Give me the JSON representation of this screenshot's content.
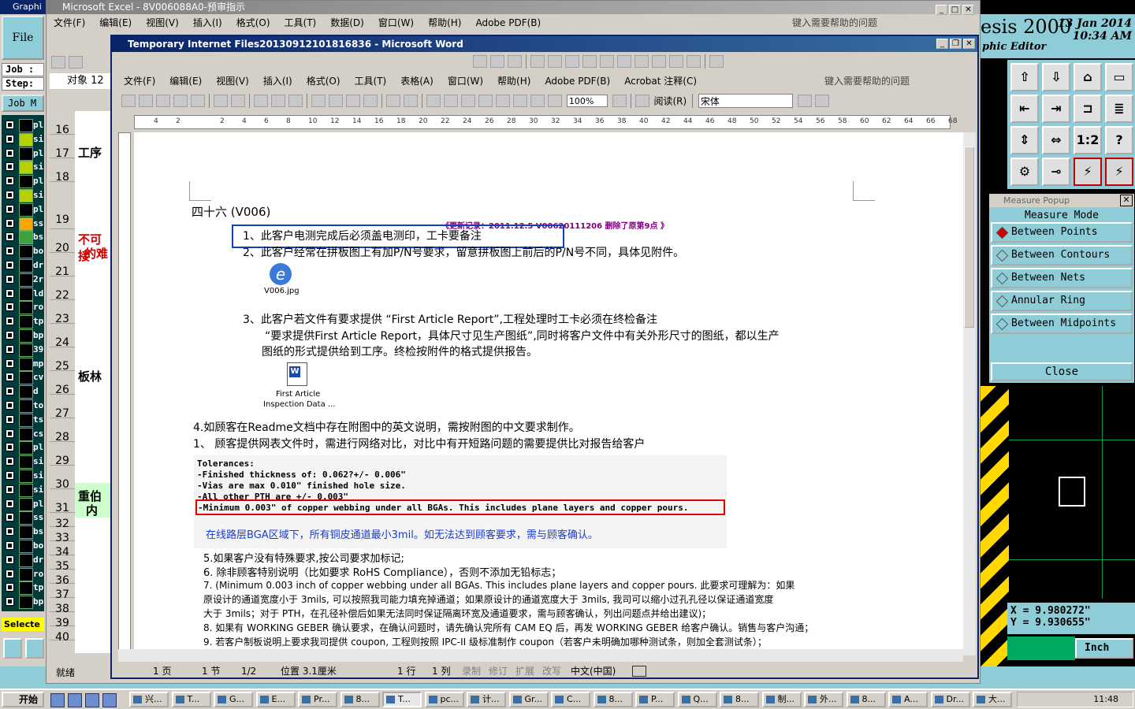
{
  "genesis": {
    "left_title": "Graphi",
    "file_button": "File",
    "job_label": "Job :",
    "step_label": "Step:",
    "job_menu": "Job M",
    "layers": [
      "pl",
      "si",
      "pl",
      "si",
      "pl",
      "si",
      "pl",
      "ss",
      "bs",
      "bo",
      "dr",
      "2r",
      "ld",
      "ro",
      "tp",
      "bp",
      "39",
      "mp",
      "cv",
      "d",
      "to",
      "ts",
      "cs",
      "pl",
      "si",
      "si",
      "si",
      "pl",
      "ss",
      "bs",
      "bo",
      "dr",
      "ro",
      "tp",
      "bp"
    ],
    "selected_label": "Selecte",
    "app_title": "esis 2000",
    "app_subtitle": "phic Editor",
    "date": "13 Jan 2014",
    "time": "10:34 AM",
    "tools": [
      "⇧",
      "⇩",
      "⌂",
      "▭",
      "⇤",
      "⇥",
      "⊐",
      "≣",
      "⇕",
      "⇔",
      "1:2",
      "?",
      "⚙",
      "⊸",
      "⚡",
      "⚡"
    ],
    "x_readout": "X = 9.980272\"",
    "y_readout": "Y = 9.930655\"",
    "units": "Inch"
  },
  "measure_popup": {
    "title": "Measure Popup",
    "mode_label": "Measure Mode",
    "options": [
      {
        "label": "Between Points",
        "selected": true
      },
      {
        "label": "Between Contours",
        "selected": false
      },
      {
        "label": "Between Nets",
        "selected": false
      },
      {
        "label": "Annular Ring",
        "selected": false
      },
      {
        "label": "Between Midpoints",
        "selected": false
      }
    ],
    "close": "Close"
  },
  "excel": {
    "title": "Microsoft Excel - 8V006088A0-预审指示",
    "menu": [
      "文件(F)",
      "编辑(E)",
      "视图(V)",
      "插入(I)",
      "格式(O)",
      "工具(T)",
      "数据(D)",
      "窗口(W)",
      "帮助(H)",
      "Adobe PDF(B)"
    ],
    "help_placeholder": "键入需要帮助的问题",
    "namebox": "对象 12",
    "rows": [
      "16",
      "17",
      "18",
      "19",
      "20",
      "21",
      "22",
      "23",
      "24",
      "25",
      "26",
      "27",
      "28",
      "29",
      "30",
      "31",
      "32",
      "33",
      "34",
      "35",
      "36",
      "37",
      "38",
      "39",
      "40"
    ],
    "cell_texts": [
      "工序",
      "不可接",
      "的难",
      "板林",
      "重伯",
      "内"
    ],
    "status": "就绪"
  },
  "word": {
    "title": "Temporary Internet Files20130912101816836 - Microsoft Word",
    "menu": [
      "文件(F)",
      "编辑(E)",
      "视图(V)",
      "插入(I)",
      "格式(O)",
      "工具(T)",
      "表格(A)",
      "窗口(W)",
      "帮助(H)",
      "Adobe PDF(B)",
      "Acrobat 注释(C)"
    ],
    "help_placeholder": "键入需要帮助的问题",
    "zoom": "100%",
    "read_button": "阅读(R)",
    "font": "宋体",
    "ruler_numbers": [
      "4",
      "2",
      "",
      "2",
      "4",
      "6",
      "8",
      "10",
      "12",
      "14",
      "16",
      "18",
      "20",
      "22",
      "24",
      "26",
      "28",
      "30",
      "32",
      "34",
      "36",
      "38",
      "40",
      "42",
      "44",
      "46",
      "48",
      "50",
      "52",
      "54",
      "56",
      "58",
      "60",
      "62",
      "64",
      "66",
      "68"
    ],
    "doc": {
      "heading": "四十六  (V006)",
      "update_note": "《更新记录：2011.12.5      V00620111206      删除了原第9点 》",
      "item1": "1、此客户电测完成后必须盖电测印，工卡要备注",
      "item2": "2、此客户经常在拼板图上有加P/N号要求，留意拼板图上前后的P/N号不同，具体见附件。",
      "attach1": "V006.jpg",
      "item3": "3、此客户若文件有要求提供 “First Article  Report”,工程处理时工卡必须在终检备注",
      "item3_line2": "“要求提供First Article  Report，具体尺寸见生产图纸”,同时将客户文件中有关外形尺寸的图纸，都以生产",
      "item3_line3": "图纸的形式提供给到工序。终检按附件的格式提供报告。",
      "attach2_line1": "First Article",
      "attach2_line2": "Inspection Data ...",
      "item4": "4.如顾客在Readme文档中存在附图中的英文说明，需按附图的中文要求制作。",
      "item1b": "1、 顾客提供网表文件时，需进行网络对比，对比中有开短路问题的需要提供比对报告给客户",
      "tol_title": "Tolerances:",
      "tol_1": "-Finished thickness of: 0.062?+/- 0.006\"",
      "tol_2": "-Vias are max 0.010\" finished hole size.",
      "tol_3": "-All other PTH are +/- 0.003\"",
      "tol_4": "-Minimum 0.003\" of copper webbing under all BGAs. This includes plane layers and copper pours.",
      "tol_note": "在线路层BGA区域下，所有铜皮通道最小3mil。如无法达到顾客要求，需与顾客确认。",
      "item5": "5.如果客户没有特殊要求,按公司要求加标记;",
      "item6": "6. 除非顾客特别说明（比如要求 RoHS Compliance），否则不添加无铅标志；",
      "item7_l1": "7. (Minimum 0.003 inch of copper webbing under all BGAs. This includes plane layers and copper pours. 此要求可理解为：如果",
      "item7_l2": "原设计的通道宽度小于 3mils, 可以按照我司能力填充掉通道；如果原设计的通道宽度大于 3mils, 我司可以缩小过孔孔径以保证通道宽度",
      "item7_l3": "大于 3mils；对于 PTH，在孔径补偿后如果无法同时保证隔离环宽及通道要求，需与顾客确认，列出问题点并给出建议)；",
      "item8": "8. 如果有 WORKING GEBER 确认要求，在确认问题时，请先确认完所有 CAM EQ 后，再发 WORKING GEBER 给客户确认。销售与客户沟通；",
      "item9": "9. 若客户制板说明上要求我司提供 coupon, 工程则按照 IPC-II 级标准制作 coupon（若客户未明确加哪种测试条，则加全套测试条）；"
    },
    "status": {
      "page": "1 页",
      "section": "1 节",
      "pages": "1/2",
      "position": "位置 3.1厘米",
      "line": "1 行",
      "column": "1 列",
      "rec": "录制",
      "trk": "修订",
      "ext": "扩展",
      "ovr": "改写",
      "lang": "中文(中国)"
    }
  },
  "taskbar": {
    "start": "开始",
    "items": [
      "兴...",
      "T...",
      "G...",
      "E...",
      "Pr...",
      "8...",
      "T...",
      "pc...",
      "计...",
      "Gr...",
      "C...",
      "8...",
      "P...",
      "Q...",
      "8...",
      "制...",
      "外...",
      "8...",
      "A...",
      "Dr...",
      "大..."
    ],
    "clock": "11:48"
  },
  "colors": {
    "highlight_blue": "#1040c0",
    "highlight_red": "#e00000",
    "update_purple": "#800080",
    "note_blue": "#1a3cc8"
  }
}
